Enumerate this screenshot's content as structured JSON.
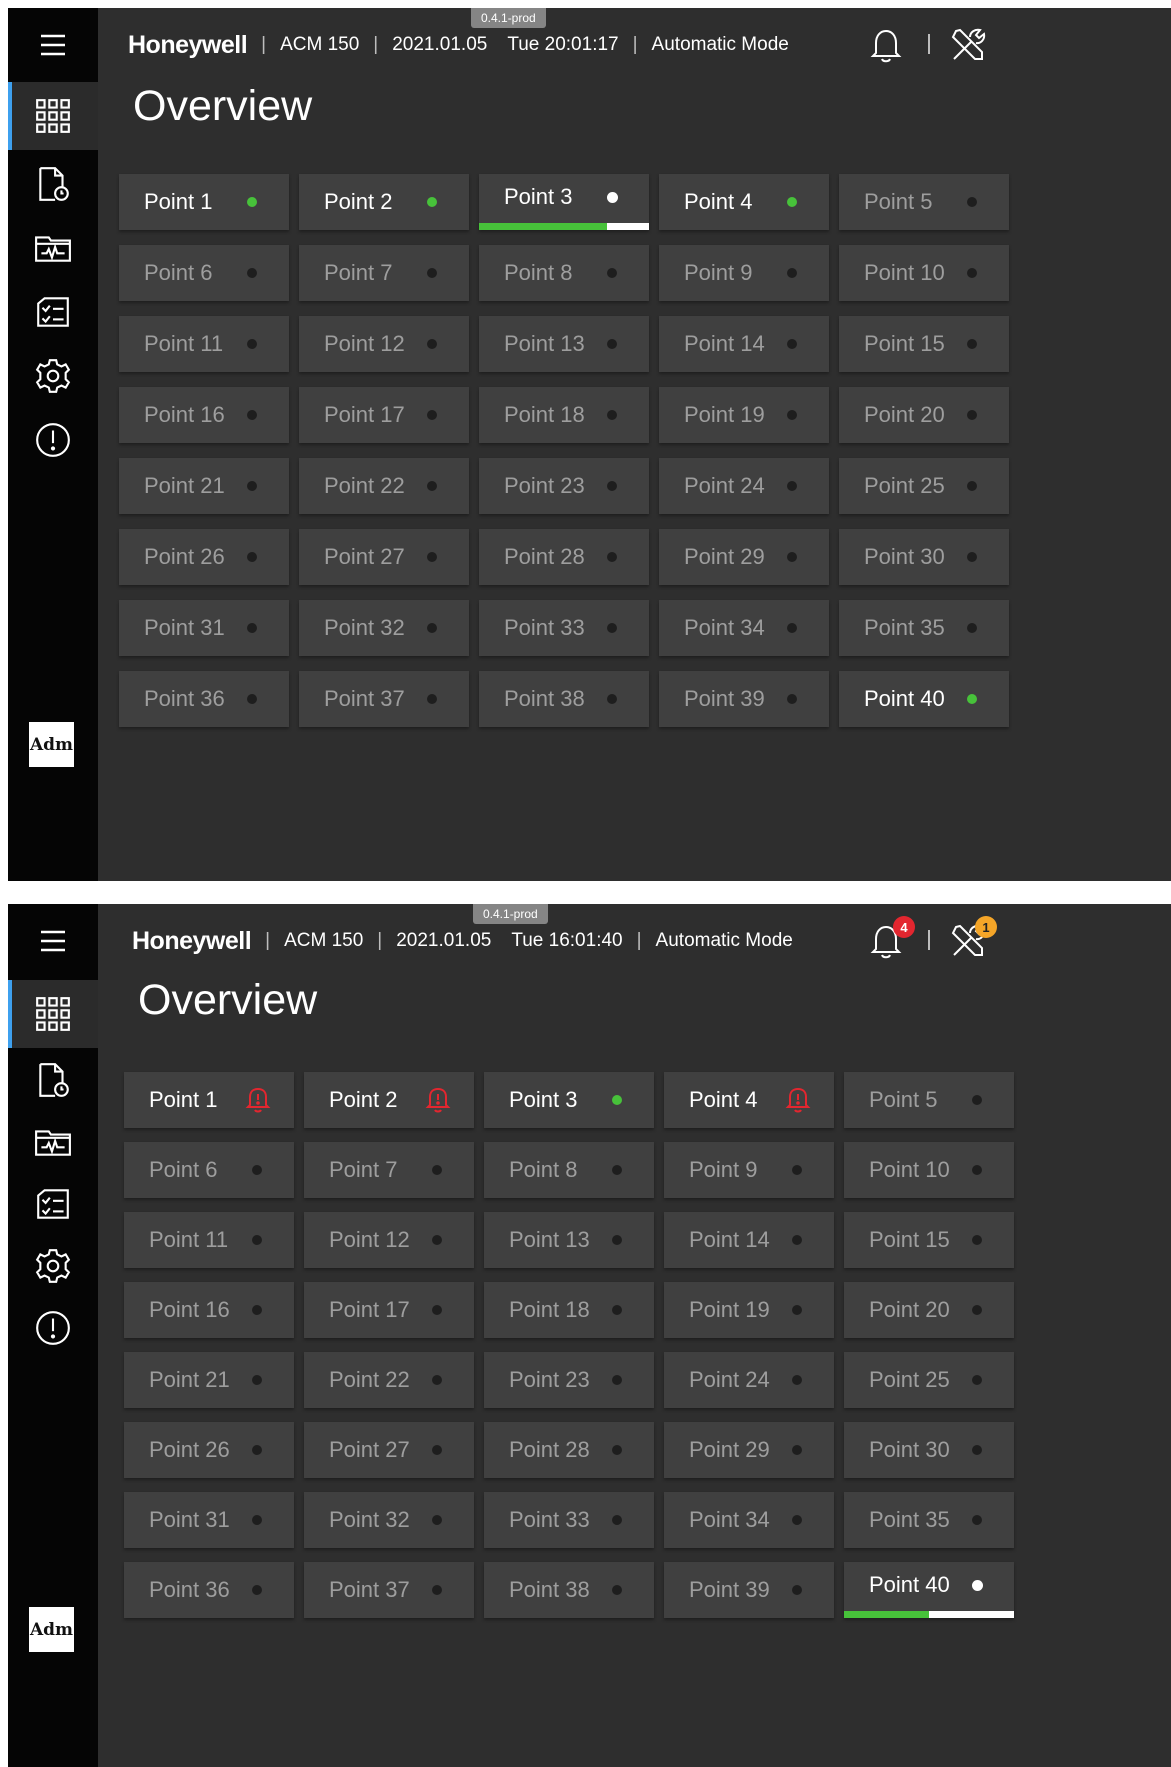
{
  "screens": [
    {
      "version": "0.4.1-prod",
      "brand": "Honeywell",
      "device": "ACM 150",
      "date": "2021.01.05",
      "time": "Tue 20:01:17",
      "mode": "Automatic Mode",
      "title": "Overview",
      "user": "Adm",
      "notifications_count": "",
      "tools_count": "",
      "points": [
        {
          "label": "Point 1",
          "state": "green"
        },
        {
          "label": "Point 2",
          "state": "green"
        },
        {
          "label": "Point 3",
          "state": "active",
          "progress": 0.75
        },
        {
          "label": "Point 4",
          "state": "green"
        },
        {
          "label": "Point 5",
          "state": "off"
        },
        {
          "label": "Point 6",
          "state": "off"
        },
        {
          "label": "Point 7",
          "state": "off"
        },
        {
          "label": "Point 8",
          "state": "off"
        },
        {
          "label": "Point 9",
          "state": "off"
        },
        {
          "label": "Point 10",
          "state": "off"
        },
        {
          "label": "Point 11",
          "state": "off"
        },
        {
          "label": "Point 12",
          "state": "off"
        },
        {
          "label": "Point 13",
          "state": "off"
        },
        {
          "label": "Point 14",
          "state": "off"
        },
        {
          "label": "Point 15",
          "state": "off"
        },
        {
          "label": "Point 16",
          "state": "off"
        },
        {
          "label": "Point 17",
          "state": "off"
        },
        {
          "label": "Point 18",
          "state": "off"
        },
        {
          "label": "Point 19",
          "state": "off"
        },
        {
          "label": "Point 20",
          "state": "off"
        },
        {
          "label": "Point 21",
          "state": "off"
        },
        {
          "label": "Point 22",
          "state": "off"
        },
        {
          "label": "Point 23",
          "state": "off"
        },
        {
          "label": "Point 24",
          "state": "off"
        },
        {
          "label": "Point 25",
          "state": "off"
        },
        {
          "label": "Point 26",
          "state": "off"
        },
        {
          "label": "Point 27",
          "state": "off"
        },
        {
          "label": "Point 28",
          "state": "off"
        },
        {
          "label": "Point 29",
          "state": "off"
        },
        {
          "label": "Point 30",
          "state": "off"
        },
        {
          "label": "Point 31",
          "state": "off"
        },
        {
          "label": "Point 32",
          "state": "off"
        },
        {
          "label": "Point 33",
          "state": "off"
        },
        {
          "label": "Point 34",
          "state": "off"
        },
        {
          "label": "Point 35",
          "state": "off"
        },
        {
          "label": "Point 36",
          "state": "off"
        },
        {
          "label": "Point 37",
          "state": "off"
        },
        {
          "label": "Point 38",
          "state": "off"
        },
        {
          "label": "Point 39",
          "state": "off"
        },
        {
          "label": "Point 40",
          "state": "green"
        }
      ]
    },
    {
      "version": "0.4.1-prod",
      "brand": "Honeywell",
      "device": "ACM 150",
      "date": "2021.01.05",
      "time": "Tue 16:01:40",
      "mode": "Automatic Mode",
      "title": "Overview",
      "user": "Adm",
      "notifications_count": "4",
      "tools_count": "1",
      "points": [
        {
          "label": "Point 1",
          "state": "alarm"
        },
        {
          "label": "Point 2",
          "state": "alarm"
        },
        {
          "label": "Point 3",
          "state": "green"
        },
        {
          "label": "Point 4",
          "state": "alarm"
        },
        {
          "label": "Point 5",
          "state": "off"
        },
        {
          "label": "Point 6",
          "state": "off"
        },
        {
          "label": "Point 7",
          "state": "off"
        },
        {
          "label": "Point 8",
          "state": "off"
        },
        {
          "label": "Point 9",
          "state": "off"
        },
        {
          "label": "Point 10",
          "state": "off"
        },
        {
          "label": "Point 11",
          "state": "off"
        },
        {
          "label": "Point 12",
          "state": "off"
        },
        {
          "label": "Point 13",
          "state": "off"
        },
        {
          "label": "Point 14",
          "state": "off"
        },
        {
          "label": "Point 15",
          "state": "off"
        },
        {
          "label": "Point 16",
          "state": "off"
        },
        {
          "label": "Point 17",
          "state": "off"
        },
        {
          "label": "Point 18",
          "state": "off"
        },
        {
          "label": "Point 19",
          "state": "off"
        },
        {
          "label": "Point 20",
          "state": "off"
        },
        {
          "label": "Point 21",
          "state": "off"
        },
        {
          "label": "Point 22",
          "state": "off"
        },
        {
          "label": "Point 23",
          "state": "off"
        },
        {
          "label": "Point 24",
          "state": "off"
        },
        {
          "label": "Point 25",
          "state": "off"
        },
        {
          "label": "Point 26",
          "state": "off"
        },
        {
          "label": "Point 27",
          "state": "off"
        },
        {
          "label": "Point 28",
          "state": "off"
        },
        {
          "label": "Point 29",
          "state": "off"
        },
        {
          "label": "Point 30",
          "state": "off"
        },
        {
          "label": "Point 31",
          "state": "off"
        },
        {
          "label": "Point 32",
          "state": "off"
        },
        {
          "label": "Point 33",
          "state": "off"
        },
        {
          "label": "Point 34",
          "state": "off"
        },
        {
          "label": "Point 35",
          "state": "off"
        },
        {
          "label": "Point 36",
          "state": "off"
        },
        {
          "label": "Point 37",
          "state": "off"
        },
        {
          "label": "Point 38",
          "state": "off"
        },
        {
          "label": "Point 39",
          "state": "off"
        },
        {
          "label": "Point 40",
          "state": "active",
          "progress": 0.5
        }
      ]
    }
  ],
  "icons": {
    "menu": "hamburger-menu-icon",
    "overview": "grid-icon",
    "reports": "document-clock-icon",
    "trends": "folder-waveform-icon",
    "checklist": "checklist-icon",
    "settings": "gear-icon",
    "alerts": "exclamation-circle-icon",
    "notifications": "bell-icon",
    "tools": "tools-icon"
  },
  "colors": {
    "background": "#2e2e2e",
    "sidebar": "#050505",
    "tile": "#404040",
    "ok_green": "#47c23a",
    "alarm_red": "#e3262f",
    "warning_orange": "#f4a528",
    "active_accent": "#3ea0ee"
  }
}
